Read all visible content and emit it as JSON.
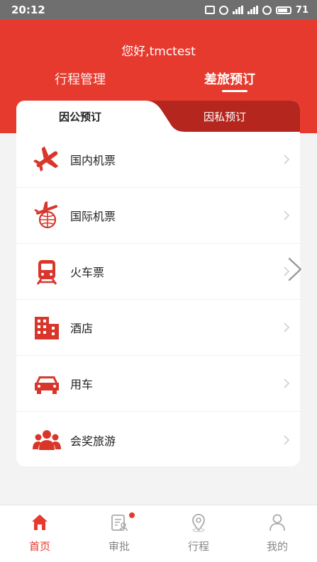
{
  "status_bar": {
    "time": "20:12",
    "battery": "71"
  },
  "header": {
    "greeting": "您好,tmctest",
    "tabs": [
      {
        "label": "行程管理",
        "active": false
      },
      {
        "label": "差旅预订",
        "active": true
      }
    ]
  },
  "booking_type": {
    "options": [
      {
        "label": "因公预订",
        "active": true
      },
      {
        "label": "因私预订",
        "active": false
      }
    ]
  },
  "menu": {
    "items": [
      {
        "label": "国内机票",
        "icon": "airplane-icon"
      },
      {
        "label": "国际机票",
        "icon": "international-flight-icon"
      },
      {
        "label": "火车票",
        "icon": "train-icon"
      },
      {
        "label": "酒店",
        "icon": "hotel-icon"
      },
      {
        "label": "用车",
        "icon": "car-icon"
      },
      {
        "label": "会奖旅游",
        "icon": "group-icon"
      }
    ]
  },
  "bottom_nav": {
    "items": [
      {
        "label": "首页",
        "icon": "home-icon",
        "active": true
      },
      {
        "label": "审批",
        "icon": "approval-icon",
        "active": false,
        "badge": true
      },
      {
        "label": "行程",
        "icon": "location-pin-icon",
        "active": false
      },
      {
        "label": "我的",
        "icon": "user-icon",
        "active": false
      }
    ]
  },
  "colors": {
    "brand": "#e63a2e",
    "segment_dark": "#b5261e",
    "icon_red": "#d9362b"
  }
}
